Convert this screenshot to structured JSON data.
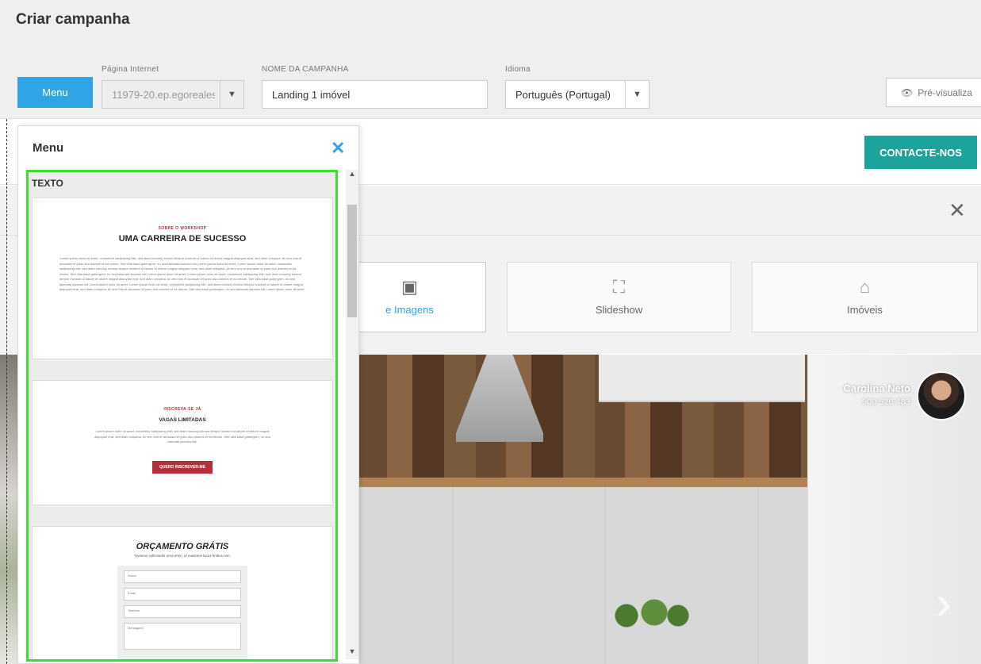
{
  "header": {
    "title": "Criar campanha",
    "menu_button": "Menu",
    "website_label": "Página Internet",
    "website_value": "11979-20.ep.egoreales",
    "campaign_label": "NOME DA CAMPANHA",
    "campaign_value": "Landing 1 imóvel",
    "language_label": "Idioma",
    "language_value": "Português (Portugal)",
    "preview_button": "Pré-visualiza"
  },
  "site": {
    "contact_button": "CONTACTE-NOS",
    "close_glyph": "✕"
  },
  "sections": {
    "tiles": [
      {
        "label": "e Imagens",
        "icon": "image-text-icon",
        "glyph": "▣",
        "active": true
      },
      {
        "label": "Slideshow",
        "icon": "slideshow-icon",
        "glyph": "⛶",
        "active": false
      },
      {
        "label": "Imóveis",
        "icon": "house-icon",
        "glyph": "⌂",
        "active": false
      }
    ]
  },
  "agent": {
    "name": "Carolina Neto",
    "phone": "900 526 483"
  },
  "menu_panel": {
    "title": "Menu",
    "close_glyph": "✕",
    "section_heading": "TEXTO",
    "templates": [
      {
        "eyebrow": "SOBRE O WORKSHOP",
        "heading": "UMA CARREIRA DE SUCESSO",
        "body": "Lorem ipsum dolor sit amet, consetetur sadipscing elitr, sed diam nonumy eirmod tempor invidunt ut labore et dolore magna aliquyam erat, sed diam voluptua. At vero eos et accusam et justo duo dolores et ea rebum. Stet clita kasd gubergren, no sea takimata sanctus est Lorem ipsum dolor sit amet. Lorem ipsum dolor sit amet, consetetur sadipscing elitr, sed diam nonumy eirmod tempor invidunt ut labore et dolore magna aliquyam erat, sed diam voluptua. At vero eos et accusam et justo duo dolores et ea rebum. Stet clita kasd gubergren, no sea takimata sanctus est Lorem ipsum dolor sit amet. Lorem ipsum dolor sit amet, consetetur sadipscing elitr, sed diam nonumy eirmod tempor invidunt ut labore et dolore magna aliquyam erat, sed diam voluptua. At vero eos et accusam et justo duo dolores et ea rebum. Stet clita kasd gubergren, no sea takimata sanctus est Lorem ipsum dolor sit amet. Lorem ipsum dolor sit amet, consetetur sadipscing elitr, sed diam nonumy eirmod tempor invidunt ut labore et dolore magna aliquyam erat, sed diam voluptua. At vero eos et accusam et justo duo dolores et ea rebum. Stet clita kasd gubergren, no sea takimata sanctus est Lorem ipsum dolor sit amet."
      },
      {
        "eyebrow": "INSCREVA-SE JÁ",
        "heading": "VAGAS LIMITADAS",
        "body": "Lorem ipsum dolor sit amet, consetetur sadipscing elitr, sed diam nonumy eirmod tempor invidunt ut labore et dolore magna aliquyam erat, sed diam voluptua. At vero eos et accusam et justo duo dolores et ea rebum. Stet clita kasd gubergren, no sea takimata sanctus est.",
        "button": "QUERO INSCREVER-ME"
      },
      {
        "heading": "ORÇAMENTO GRÁTIS",
        "subheading": "Vivamus sollicitudin urna enim, id maximus lacus finibus non.",
        "fields": [
          "Nome",
          "Email",
          "Telefone",
          "Mensagem"
        ]
      }
    ]
  },
  "colors": {
    "accent": "#2fa4e7",
    "contact": "#1ba39c",
    "highlight": "#39e030",
    "template_red": "#b5303a"
  }
}
